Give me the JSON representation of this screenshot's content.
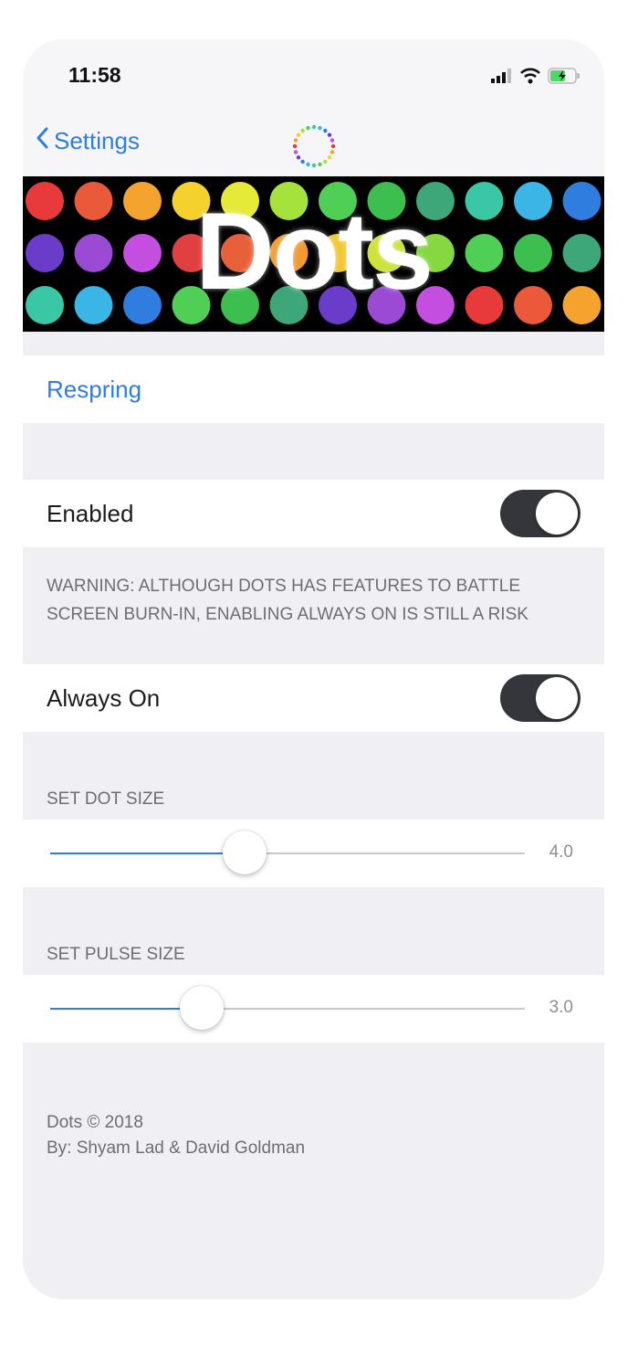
{
  "status_bar": {
    "time": "11:58",
    "signal_icon": "signal-bars-icon",
    "wifi_icon": "wifi-icon",
    "battery_icon": "battery-charging-icon",
    "battery_color": "#4cd964"
  },
  "nav": {
    "back_label": "Settings",
    "back_icon": "chevron-left-icon",
    "title_icon": "dots-ring-icon"
  },
  "banner": {
    "title": "Dots",
    "dot_colors": [
      [
        "#e83a3a",
        "#ea5a3a",
        "#f4a32e",
        "#f5d12e",
        "#e5ea39",
        "#a5e23b",
        "#4fcf56",
        "#3cbf4f",
        "#3ea77a",
        "#3ac7a5",
        "#3ab5e6",
        "#2f7ddf"
      ],
      [
        "#6a3cc9",
        "#9b4ad4",
        "#c34ee0",
        "#e04040",
        "#e8603a",
        "#f29a30",
        "#f2c732",
        "#cde23a",
        "#86d841",
        "#4fcf56",
        "#3cbf4f",
        "#3ea77a"
      ],
      [
        "#3ac7a5",
        "#3ab5e6",
        "#2f7ddf",
        "#4fcf56",
        "#3cbf4f",
        "#3ea77a",
        "#6a3cc9",
        "#9b4ad4",
        "#c34ee0",
        "#e83a3a",
        "#ea5a3a",
        "#f4a32e"
      ]
    ]
  },
  "respring": {
    "label": "Respring"
  },
  "enabled": {
    "label": "Enabled",
    "on": true
  },
  "warning": {
    "text": "WARNING: ALTHOUGH DOTS HAS FEATURES TO BATTLE SCREEN BURN-IN, ENABLING ALWAYS ON IS STILL A RISK"
  },
  "always_on": {
    "label": "Always On",
    "on": true
  },
  "dot_size": {
    "header": "SET DOT SIZE",
    "value": 4.0,
    "value_label": "4.0",
    "fraction": 0.41
  },
  "pulse_size": {
    "header": "SET PULSE SIZE",
    "value": 3.0,
    "value_label": "3.0",
    "fraction": 0.32
  },
  "footer": {
    "line1": "Dots © 2018",
    "line2": "By: Shyam Lad & David Goldman"
  },
  "accent_color": "#2f7ddf",
  "toggle_color": "#34363b"
}
